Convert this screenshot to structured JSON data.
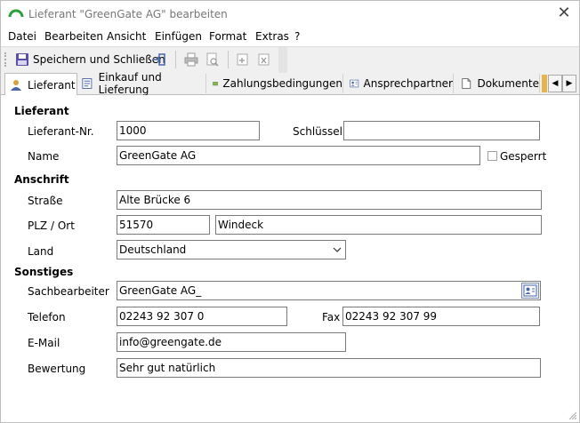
{
  "window": {
    "title": "Lieferant \"GreenGate AG\" bearbeiten",
    "close_symbol": "✕"
  },
  "menu": [
    "Datei",
    "Bearbeiten",
    "Ansicht",
    "Einfügen",
    "Format",
    "Extras",
    "?"
  ],
  "toolbar": {
    "save_close_label": "Speichern und Schließen",
    "icons": [
      "save-icon",
      "exit-icon",
      "print-icon",
      "print-preview-icon",
      "new-record-icon",
      "delete-record-icon"
    ]
  },
  "tabs": [
    {
      "label": "Lieferant",
      "icon": "supplier-icon",
      "active": true
    },
    {
      "label": "Einkauf und Lieferung",
      "icon": "purchase-icon",
      "active": false
    },
    {
      "label": "Zahlungsbedingungen",
      "icon": "payment-icon",
      "active": false
    },
    {
      "label": "Ansprechpartner",
      "icon": "contact-card-icon",
      "active": false
    },
    {
      "label": "Dokumente",
      "icon": "document-icon",
      "active": false
    }
  ],
  "form": {
    "sections": {
      "lieferant": "Lieferant",
      "anschrift": "Anschrift",
      "sonstiges": "Sonstiges"
    },
    "labels": {
      "lieferant_nr": "Lieferant-Nr.",
      "schluessel": "Schlüssel",
      "name": "Name",
      "gesperrt": "Gesperrt",
      "strasse": "Straße",
      "plz_ort": "PLZ / Ort",
      "land": "Land",
      "sachbearbeiter": "Sachbearbeiter",
      "telefon": "Telefon",
      "fax": "Fax",
      "email": "E-Mail",
      "bewertung": "Bewertung"
    },
    "values": {
      "lieferant_nr": "1000",
      "schluessel": "",
      "name": "GreenGate AG",
      "gesperrt": false,
      "strasse": "Alte Brücke 6",
      "plz": "51570",
      "ort": "Windeck",
      "land": "Deutschland",
      "sachbearbeiter": "GreenGate AG_",
      "telefon": "02243 92 307 0",
      "fax": "02243 92 307 99",
      "email": "info@greengate.de",
      "bewertung": "Sehr gut natürlich"
    }
  },
  "colors": {
    "app_icon_green": "#2e9e3e",
    "toolbar_bg": "#f0f0f0",
    "field_border": "#7a7a7a"
  }
}
